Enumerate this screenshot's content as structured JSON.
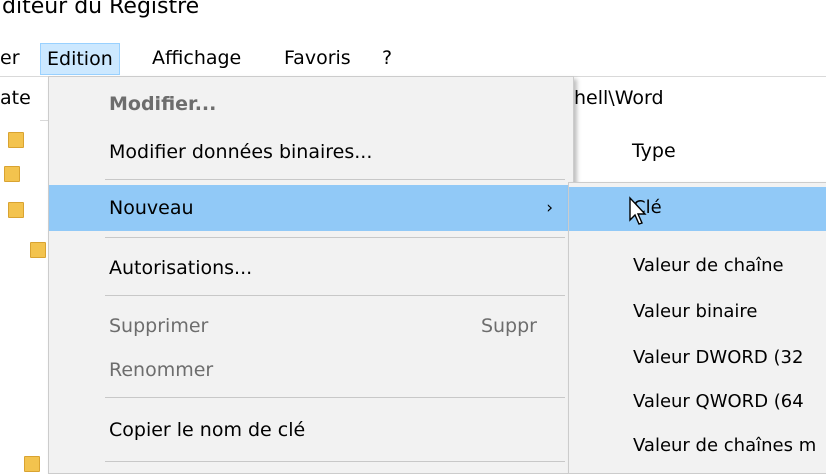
{
  "window": {
    "title": "diteur du Registre"
  },
  "menubar": {
    "items": [
      {
        "label": "er"
      },
      {
        "label": "Edition",
        "active": true
      },
      {
        "label": "Affichage"
      },
      {
        "label": "Favoris"
      },
      {
        "label": "?"
      }
    ]
  },
  "address": {
    "left_fragment": "ate",
    "right_fragment": "hell\\Word"
  },
  "list": {
    "type_header": "Type"
  },
  "edit_menu": {
    "modifier": "Modifier...",
    "modifier_binaire": "Modifier données binaires...",
    "nouveau": "Nouveau",
    "autorisations": "Autorisations...",
    "supprimer": "Supprimer",
    "supprimer_shortcut": "Suppr",
    "renommer": "Renommer",
    "copier": "Copier le nom de clé"
  },
  "new_submenu": {
    "items": [
      {
        "label": "Clé"
      },
      {
        "label": "Valeur de chaîne"
      },
      {
        "label": "Valeur binaire"
      },
      {
        "label": "Valeur DWORD (32"
      },
      {
        "label": "Valeur QWORD (64"
      },
      {
        "label": "Valeur de chaînes m"
      }
    ]
  },
  "icons": {
    "folder": "folder-icon",
    "submenu_arrow": "chevron-right-icon",
    "cursor": "mouse-pointer-icon"
  },
  "colors": {
    "highlight": "#91c9f7",
    "menu_bg": "#f2f2f2",
    "active_menu": "#cce8ff"
  }
}
